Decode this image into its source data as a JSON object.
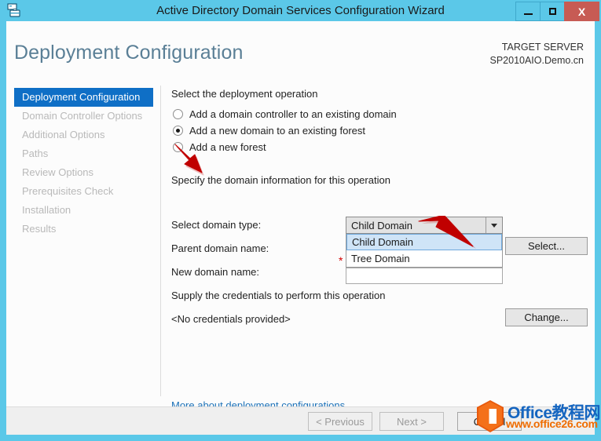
{
  "window": {
    "title": "Active Directory Domain Services Configuration Wizard",
    "icon": "server-wizard-icon",
    "minimize_label": "Minimize",
    "maximize_label": "Maximize",
    "close_label": "X"
  },
  "header": {
    "page_title": "Deployment Configuration",
    "target_server_label": "TARGET SERVER",
    "target_server_value": "SP2010AIO.Demo.cn"
  },
  "sidebar": {
    "items": [
      {
        "label": "Deployment Configuration",
        "active": true
      },
      {
        "label": "Domain Controller Options",
        "active": false
      },
      {
        "label": "Additional Options",
        "active": false
      },
      {
        "label": "Paths",
        "active": false
      },
      {
        "label": "Review Options",
        "active": false
      },
      {
        "label": "Prerequisites Check",
        "active": false
      },
      {
        "label": "Installation",
        "active": false
      },
      {
        "label": "Results",
        "active": false
      }
    ]
  },
  "main": {
    "operation_section_heading": "Select the deployment operation",
    "operations": [
      {
        "label": "Add a domain controller to an existing domain",
        "checked": false
      },
      {
        "label": "Add a new domain to an existing forest",
        "checked": true
      },
      {
        "label": "Add a new forest",
        "checked": false
      }
    ],
    "domain_section_heading": "Specify the domain information for this operation",
    "domain_type_label": "Select domain type:",
    "domain_type_value": "Child Domain",
    "domain_type_options": [
      "Child Domain",
      "Tree Domain"
    ],
    "domain_type_selected_option": "Child Domain",
    "parent_domain_label": "Parent domain name:",
    "parent_domain_value": "",
    "new_domain_label": "New domain name:",
    "new_domain_value": "",
    "new_domain_required_marker": "*",
    "select_button": "Select...",
    "credentials_section_heading": "Supply the credentials to perform this operation",
    "credentials_value": "<No credentials provided>",
    "change_button": "Change...",
    "more_link": "More about deployment configurations"
  },
  "footer": {
    "previous_button": "< Previous",
    "next_button": "Next >",
    "cancel_button": "Cancel"
  },
  "watermark": {
    "line1": "Office",
    "line1_cn": "教程网",
    "line2": "www.office26.com",
    "logo": "office-logo-icon"
  },
  "colors": {
    "titlebar": "#5bc8e8",
    "close_button": "#c75b54",
    "sidebar_active": "#0f6fc6",
    "page_title": "#5a7f96",
    "link": "#1d72b8",
    "annotation_arrow": "#c00000",
    "required_marker": "#d40000"
  }
}
